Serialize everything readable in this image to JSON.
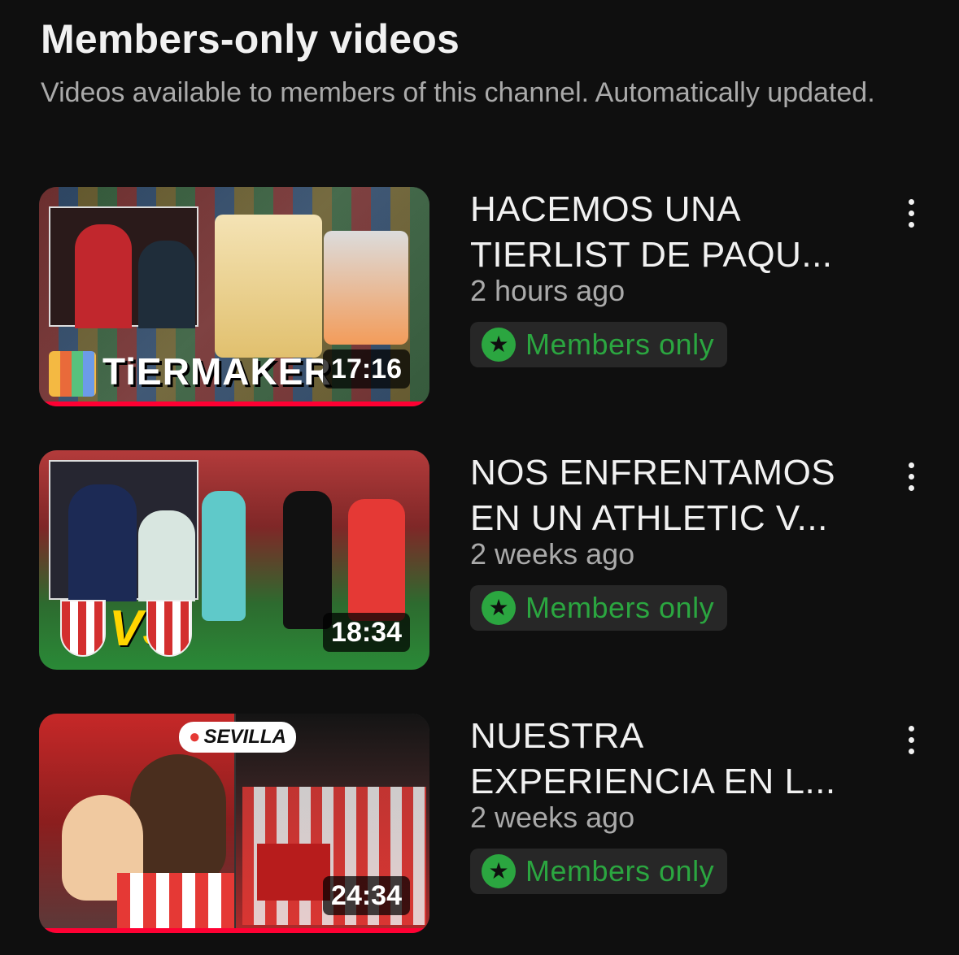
{
  "page": {
    "title": "Members-only videos",
    "subtitle": "Videos available to members of this channel. Automatically updated."
  },
  "videos": [
    {
      "title_line1": "HACEMOS UNA",
      "title_line2": "TIERLIST DE PAQU...",
      "age": "2 hours ago",
      "badge_label": "Members only",
      "duration": "17:16",
      "thumb_text": "TiERMAKER"
    },
    {
      "title_line1": "NOS ENFRENTAMOS",
      "title_line2": "EN UN ATHLETIC V...",
      "age": "2 weeks ago",
      "badge_label": "Members only",
      "duration": "18:34",
      "thumb_text": "VS"
    },
    {
      "title_line1": "NUESTRA",
      "title_line2": "EXPERIENCIA EN L...",
      "age": "2 weeks ago",
      "badge_label": "Members only",
      "duration": "24:34",
      "thumb_text": "SEVILLA"
    }
  ],
  "icons": {
    "badge": "star-icon",
    "menu": "more-vert-icon",
    "location": "location-pin-icon"
  },
  "colors": {
    "background": "#0f0f0f",
    "badge_green": "#2ba640",
    "progress_red": "#ff0033"
  }
}
